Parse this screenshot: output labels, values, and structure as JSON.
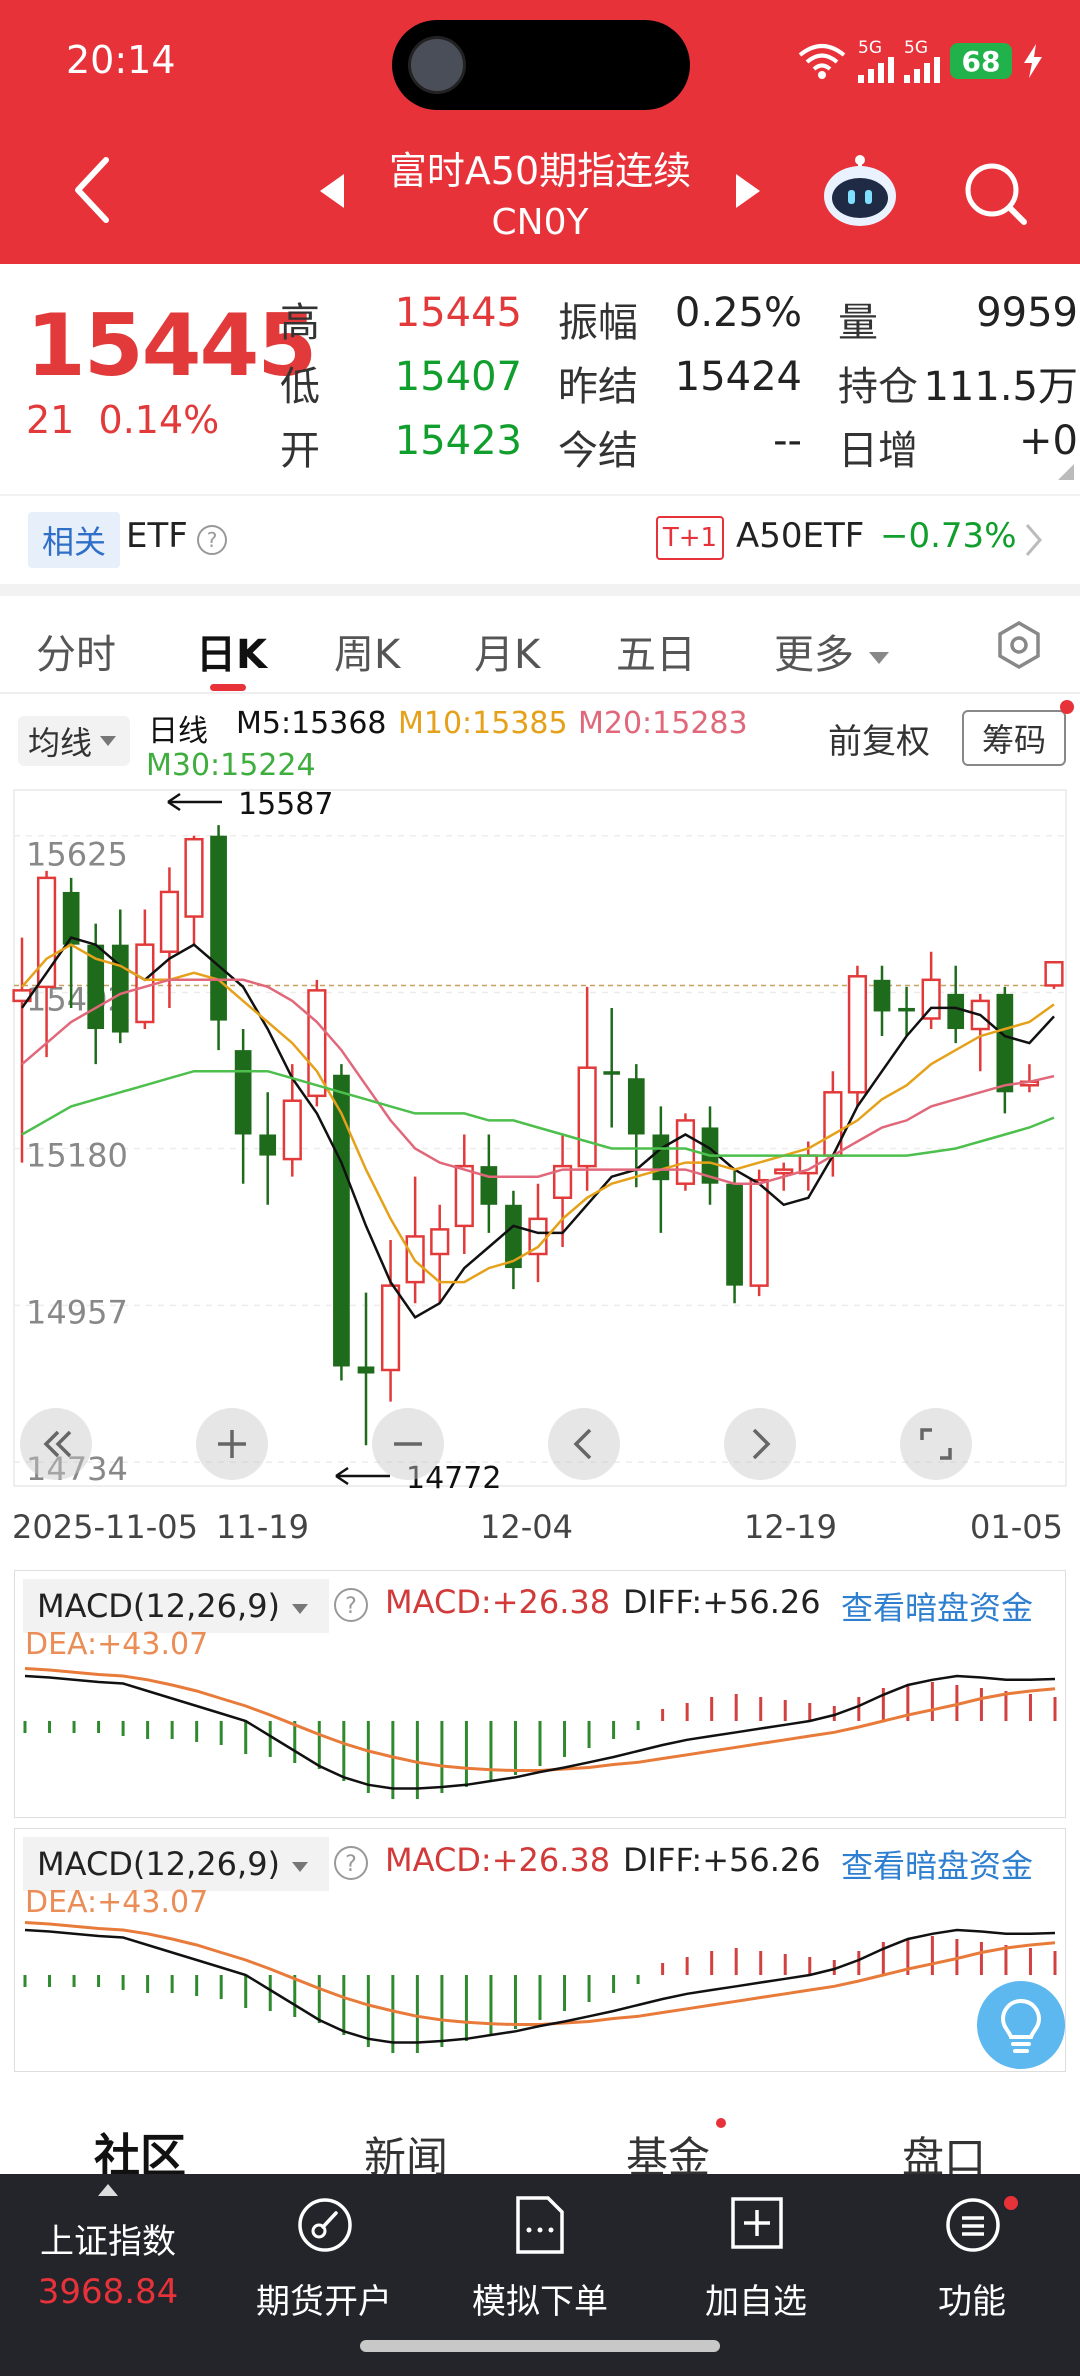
{
  "status_bar": {
    "time": "20:14",
    "net1": "5G",
    "net2": "5G",
    "battery": "68"
  },
  "header": {
    "title": "富时A50期指连续",
    "code": "CN0Y"
  },
  "quote": {
    "price": "15445",
    "change": "21",
    "change_pct": "0.14%",
    "high_label": "高",
    "high": "15445",
    "low_label": "低",
    "low": "15407",
    "open_label": "开",
    "open": "15423",
    "amp_label": "振幅",
    "amp": "0.25%",
    "prev_settle_label": "昨结",
    "prev_settle": "15424",
    "settle_label": "今结",
    "settle": "--",
    "vol_label": "量",
    "vol": "9959",
    "oi_label": "持仓",
    "oi": "111.5万",
    "daily_inc_label": "日增",
    "daily_inc": "+0"
  },
  "related": {
    "tag": "相关",
    "etf_label": "ETF",
    "badge": "T+1",
    "name": "A50ETF",
    "pct": "−0.73%"
  },
  "tabs": [
    "分时",
    "日K",
    "周K",
    "月K",
    "五日",
    "更多"
  ],
  "kline": {
    "ma_selector": "均线",
    "period": "日线",
    "m5": "M5:15368",
    "m10": "M10:15385",
    "m20": "M20:15283",
    "m30": "M30:15224",
    "adjust": "前复权",
    "chips": "筹码",
    "y_labels": [
      "15625",
      "15402",
      "15180",
      "14957",
      "14734"
    ],
    "x_labels": [
      "2025-11-05",
      "11-19",
      "12-04",
      "12-19",
      "01-05"
    ],
    "high_marker": "15587",
    "low_marker": "14772",
    "colors": {
      "up": "#e23a3a",
      "down": "#1f6b1c",
      "m5": "#111111",
      "m10": "#e5a11a",
      "m20": "#e0687a",
      "m30": "#4cbf4c"
    }
  },
  "chart_data": {
    "type": "candlestick",
    "x_range": [
      "2025-11-05",
      "01-05"
    ],
    "y_labels_visible": [
      15625,
      15402,
      15180,
      14957,
      14734
    ],
    "ylim": [
      14734,
      15625
    ],
    "candles": [
      {
        "o": 15390,
        "h": 15480,
        "l": 15160,
        "c": 15405
      },
      {
        "o": 15410,
        "h": 15575,
        "l": 15310,
        "c": 15565
      },
      {
        "o": 15545,
        "h": 15565,
        "l": 15380,
        "c": 15470
      },
      {
        "o": 15470,
        "h": 15500,
        "l": 15300,
        "c": 15350
      },
      {
        "o": 15470,
        "h": 15520,
        "l": 15330,
        "c": 15345
      },
      {
        "o": 15360,
        "h": 15520,
        "l": 15350,
        "c": 15470
      },
      {
        "o": 15460,
        "h": 15580,
        "l": 15380,
        "c": 15545
      },
      {
        "o": 15510,
        "h": 15625,
        "l": 15470,
        "c": 15620
      },
      {
        "o": 15625,
        "h": 15640,
        "l": 15320,
        "c": 15362
      },
      {
        "o": 15320,
        "h": 15350,
        "l": 15130,
        "c": 15200
      },
      {
        "o": 15200,
        "h": 15260,
        "l": 15100,
        "c": 15170
      },
      {
        "o": 15165,
        "h": 15300,
        "l": 15140,
        "c": 15248
      },
      {
        "o": 15255,
        "h": 15420,
        "l": 15240,
        "c": 15405
      },
      {
        "o": 15285,
        "h": 15300,
        "l": 14850,
        "c": 14870
      },
      {
        "o": 14870,
        "h": 14975,
        "l": 14758,
        "c": 14860
      },
      {
        "o": 14865,
        "h": 15050,
        "l": 14820,
        "c": 14985
      },
      {
        "o": 14990,
        "h": 15140,
        "l": 14960,
        "c": 15055
      },
      {
        "o": 15030,
        "h": 15100,
        "l": 14960,
        "c": 15065
      },
      {
        "o": 15070,
        "h": 15200,
        "l": 15030,
        "c": 15155
      },
      {
        "o": 15155,
        "h": 15200,
        "l": 15060,
        "c": 15100
      },
      {
        "o": 15100,
        "h": 15120,
        "l": 14980,
        "c": 15010
      },
      {
        "o": 15030,
        "h": 15130,
        "l": 14990,
        "c": 15080
      },
      {
        "o": 15110,
        "h": 15200,
        "l": 15040,
        "c": 15155
      },
      {
        "o": 15155,
        "h": 15410,
        "l": 15120,
        "c": 15295
      },
      {
        "o": 15290,
        "h": 15380,
        "l": 15210,
        "c": 15285
      },
      {
        "o": 15280,
        "h": 15300,
        "l": 15125,
        "c": 15200
      },
      {
        "o": 15200,
        "h": 15240,
        "l": 15060,
        "c": 15135
      },
      {
        "o": 15130,
        "h": 15230,
        "l": 15120,
        "c": 15220
      },
      {
        "o": 15210,
        "h": 15240,
        "l": 15100,
        "c": 15130
      },
      {
        "o": 15130,
        "h": 15150,
        "l": 14960,
        "c": 14985
      },
      {
        "o": 14985,
        "h": 15150,
        "l": 14970,
        "c": 15135
      },
      {
        "o": 15145,
        "h": 15160,
        "l": 15120,
        "c": 15150
      },
      {
        "o": 15145,
        "h": 15190,
        "l": 15120,
        "c": 15170
      },
      {
        "o": 15170,
        "h": 15290,
        "l": 15140,
        "c": 15260
      },
      {
        "o": 15260,
        "h": 15440,
        "l": 15240,
        "c": 15425
      },
      {
        "o": 15420,
        "h": 15440,
        "l": 15340,
        "c": 15375
      },
      {
        "o": 15380,
        "h": 15410,
        "l": 15340,
        "c": 15375
      },
      {
        "o": 15365,
        "h": 15460,
        "l": 15350,
        "c": 15420
      },
      {
        "o": 15400,
        "h": 15440,
        "l": 15330,
        "c": 15350
      },
      {
        "o": 15350,
        "h": 15400,
        "l": 15290,
        "c": 15390
      },
      {
        "o": 15400,
        "h": 15410,
        "l": 15230,
        "c": 15260
      },
      {
        "o": 15270,
        "h": 15300,
        "l": 15260,
        "c": 15275
      },
      {
        "o": 15412,
        "h": 15445,
        "l": 15407,
        "c": 15445
      }
    ],
    "ma": {
      "M5": [
        15380,
        15430,
        15480,
        15470,
        15440,
        15420,
        15450,
        15470,
        15440,
        15410,
        15350,
        15280,
        15230,
        15160,
        15070,
        14990,
        14940,
        14960,
        15010,
        15040,
        15070,
        15060,
        15060,
        15100,
        15140,
        15150,
        15180,
        15200,
        15180,
        15150,
        15130,
        15100,
        15110,
        15170,
        15240,
        15290,
        15340,
        15380,
        15380,
        15370,
        15340,
        15330,
        15368
      ],
      "M10": [
        15410,
        15450,
        15470,
        15450,
        15440,
        15420,
        15420,
        15430,
        15420,
        15390,
        15360,
        15330,
        15290,
        15230,
        15150,
        15080,
        15020,
        14990,
        14990,
        15010,
        15020,
        15040,
        15080,
        15110,
        15130,
        15140,
        15150,
        15160,
        15160,
        15150,
        15160,
        15170,
        15180,
        15200,
        15220,
        15250,
        15270,
        15300,
        15320,
        15340,
        15350,
        15360,
        15385
      ],
      "M20": [
        15300,
        15330,
        15360,
        15380,
        15400,
        15410,
        15420,
        15420,
        15420,
        15420,
        15410,
        15390,
        15360,
        15320,
        15270,
        15220,
        15180,
        15160,
        15150,
        15140,
        15140,
        15140,
        15150,
        15150,
        15150,
        15150,
        15150,
        15150,
        15140,
        15130,
        15130,
        15140,
        15150,
        15170,
        15190,
        15210,
        15220,
        15240,
        15250,
        15260,
        15270,
        15275,
        15283
      ],
      "M30": [
        15200,
        15220,
        15240,
        15250,
        15260,
        15270,
        15280,
        15290,
        15290,
        15290,
        15290,
        15280,
        15270,
        15260,
        15250,
        15240,
        15230,
        15230,
        15230,
        15220,
        15220,
        15210,
        15200,
        15190,
        15180,
        15180,
        15180,
        15180,
        15170,
        15170,
        15170,
        15170,
        15170,
        15170,
        15170,
        15170,
        15170,
        15175,
        15180,
        15190,
        15200,
        15210,
        15224
      ]
    }
  },
  "macd": {
    "selector": "MACD(12,26,9)",
    "macd": "MACD:+26.38",
    "diff": "DIFF:+56.26",
    "dea": "DEA:+43.07",
    "link": "查看暗盘资金",
    "colors": {
      "diff": "#111111",
      "dea": "#e87a3a",
      "pos": "#d24040",
      "neg": "#2f8a2f"
    },
    "hist": [
      -20,
      -20,
      -20,
      -20,
      -25,
      -30,
      -30,
      -35,
      -40,
      -55,
      -60,
      -70,
      -80,
      -100,
      -120,
      -130,
      -130,
      -120,
      -110,
      -100,
      -90,
      -75,
      -60,
      -45,
      -30,
      -15,
      20,
      30,
      40,
      45,
      40,
      35,
      30,
      25,
      40,
      55,
      60,
      65,
      60,
      55,
      50,
      45,
      40
    ],
    "diff_line": [
      60,
      58,
      55,
      52,
      50,
      40,
      30,
      20,
      10,
      0,
      -20,
      -40,
      -60,
      -75,
      -85,
      -90,
      -90,
      -88,
      -85,
      -80,
      -75,
      -68,
      -62,
      -55,
      -48,
      -40,
      -32,
      -25,
      -20,
      -15,
      -10,
      -5,
      0,
      8,
      20,
      35,
      48,
      55,
      60,
      58,
      55,
      55,
      56
    ],
    "dea_line": [
      70,
      68,
      65,
      62,
      60,
      55,
      48,
      40,
      30,
      20,
      8,
      -5,
      -18,
      -30,
      -40,
      -48,
      -55,
      -60,
      -63,
      -65,
      -66,
      -66,
      -64,
      -62,
      -58,
      -55,
      -50,
      -45,
      -40,
      -35,
      -30,
      -25,
      -20,
      -15,
      -8,
      0,
      8,
      15,
      22,
      30,
      36,
      40,
      43
    ]
  },
  "sub_tabs": [
    "社区",
    "新闻",
    "基金",
    "盘口"
  ],
  "bottom_nav": {
    "index_name": "上证指数",
    "index_value": "3968.84",
    "items": [
      "期货开户",
      "模拟下单",
      "加自选",
      "功能"
    ]
  }
}
